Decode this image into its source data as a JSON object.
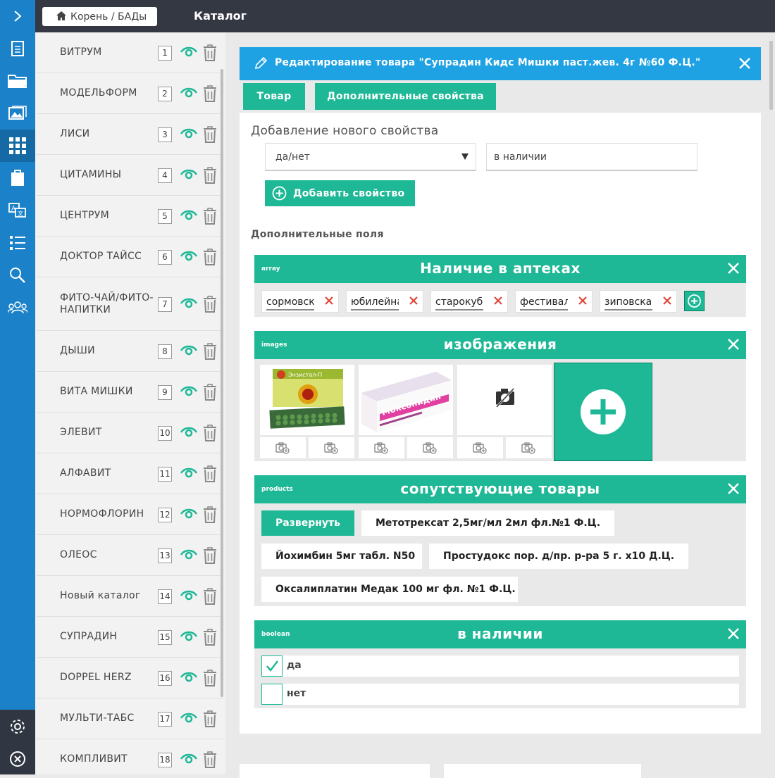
{
  "colors": {
    "accent": "#1eb896",
    "nav": "#1b82c9",
    "header": "#1ea2e3",
    "topbar": "#333843"
  },
  "topbar": {
    "breadcrumb": "Корень / БАДы",
    "title": "Каталог"
  },
  "nav_icons": [
    "menu-toggle-icon",
    "document-icon",
    "folder-icon",
    "gallery-icon",
    "catalog-grid-icon",
    "clipboard-icon",
    "translate-icon",
    "list-icon",
    "search-icon",
    "users-icon",
    "settings-icon",
    "exit-icon"
  ],
  "categories": [
    {
      "name": "ВИТРУМ",
      "num": "1"
    },
    {
      "name": "МОДЕЛЬФОРМ",
      "num": "2"
    },
    {
      "name": "ЛИСИ",
      "num": "3"
    },
    {
      "name": "ЦИТАМИНЫ",
      "num": "4"
    },
    {
      "name": "ЦЕНТРУМ",
      "num": "5"
    },
    {
      "name": "ДОКТОР ТАЙСС",
      "num": "6"
    },
    {
      "name": "ФИТО-ЧАЙ/ФИТО-НАПИТКИ",
      "num": "7"
    },
    {
      "name": "ДЫШИ",
      "num": "8"
    },
    {
      "name": "ВИТА МИШКИ",
      "num": "9"
    },
    {
      "name": "ЭЛЕВИТ",
      "num": "10"
    },
    {
      "name": "АЛФАВИТ",
      "num": "11"
    },
    {
      "name": "НОРМОФЛОРИН",
      "num": "12"
    },
    {
      "name": "ОЛЕОС",
      "num": "13"
    },
    {
      "name": "Новый каталог",
      "num": "14"
    },
    {
      "name": "СУПРАДИН",
      "num": "15"
    },
    {
      "name": "DOPPEL HERZ",
      "num": "16"
    },
    {
      "name": "МУЛЬТИ-ТАБС",
      "num": "17"
    },
    {
      "name": "КОМПЛИВИТ",
      "num": "18"
    }
  ],
  "editor": {
    "title": "Редактирование товара \"Супрадин Кидс Мишки паст.жев. 4г №60 Ф.Ц.\"",
    "tabs": [
      "Товар",
      "Дополнительные свойства"
    ],
    "new_prop_title": "Добавление нового свойства",
    "type_select": "да/нет",
    "name_input": "в наличии",
    "add_button": "Добавить свойство",
    "extra_fields_label": "Дополнительные поля"
  },
  "blocks": {
    "array": {
      "type": "array",
      "title": "Наличие в аптеках",
      "items": [
        "сормовская",
        "юбилейная",
        "старокубанская",
        "фестивальная",
        "зиповская"
      ]
    },
    "images": {
      "type": "images",
      "title": "изображения",
      "items": [
        {
          "label": "Энзистал-П"
        },
        {
          "label": "Моксонидин"
        },
        {
          "label": "no-image"
        }
      ]
    },
    "products": {
      "type": "products",
      "title": "сопутствующие товары",
      "expand": "Развернуть",
      "items": [
        "Метотрексат 2,5мг/мл 2мл фл.№1 Ф.Ц.",
        "Йохимбин 5мг табл. N50",
        "Простудокс пор. д/пр. р-ра 5 г. х10 Д.Ц.",
        "Оксалиплатин Медак 100 мг фл. №1 Ф.Ц."
      ]
    },
    "boolean": {
      "type": "boolean",
      "title": "в наличии",
      "options": [
        {
          "label": "да",
          "checked": true
        },
        {
          "label": "нет",
          "checked": false
        }
      ]
    }
  }
}
